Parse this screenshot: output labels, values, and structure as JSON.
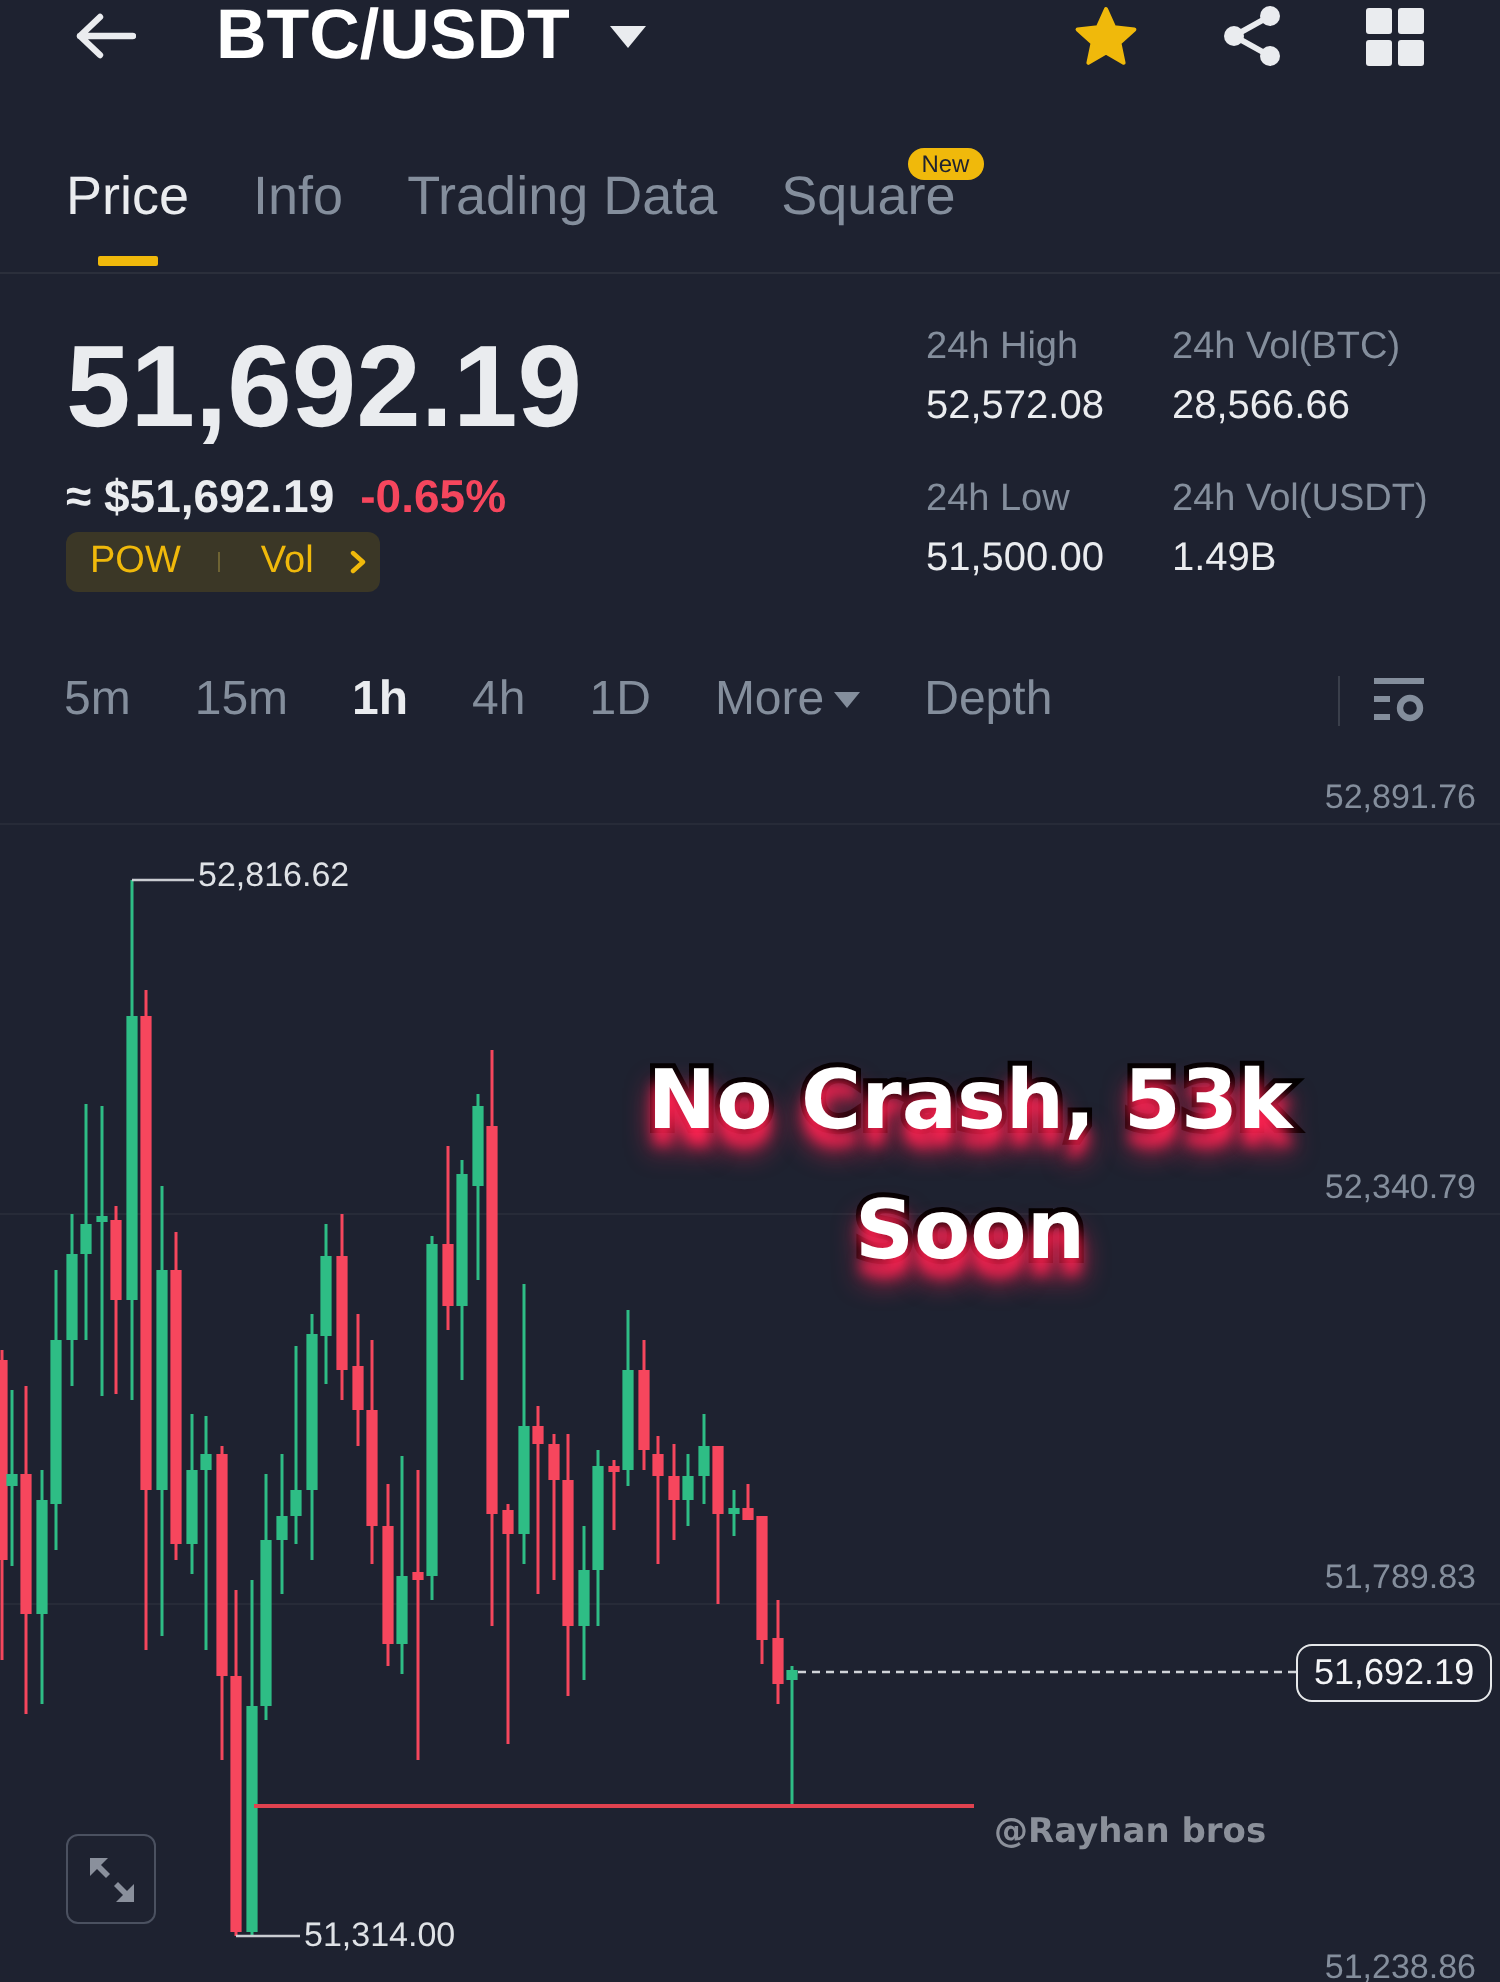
{
  "header": {
    "title": "BTC/USDT",
    "starred": true
  },
  "tabs": [
    {
      "label": "Price",
      "selected": true
    },
    {
      "label": "Info",
      "selected": false
    },
    {
      "label": "Trading Data",
      "selected": false
    },
    {
      "label": "Square",
      "selected": false,
      "badge": "New"
    }
  ],
  "ticker": {
    "last_price": "51,692.19",
    "fiat_price": "≈ $51,692.19",
    "change": "-0.65%",
    "negative": true,
    "tags": [
      "POW",
      "Vol"
    ]
  },
  "stats": [
    {
      "label": "24h High",
      "value": "52,572.08"
    },
    {
      "label": "24h Vol(BTC)",
      "value": "28,566.66"
    },
    {
      "label": "24h Low",
      "value": "51,500.00"
    },
    {
      "label": "24h Vol(USDT)",
      "value": "1.49B"
    }
  ],
  "intervals": [
    {
      "label": "5m",
      "kind": "interval",
      "selected": false
    },
    {
      "label": "15m",
      "kind": "interval",
      "selected": false
    },
    {
      "label": "1h",
      "kind": "interval",
      "selected": true
    },
    {
      "label": "4h",
      "kind": "interval",
      "selected": false
    },
    {
      "label": "1D",
      "kind": "interval",
      "selected": false
    },
    {
      "label": "More",
      "kind": "dropdown",
      "selected": false
    },
    {
      "label": "Depth",
      "kind": "view",
      "selected": false
    }
  ],
  "chart": {
    "price_axis": [
      "52,891.76",
      "52,340.79",
      "51,789.83",
      "51,238.86"
    ],
    "high_label": "52,816.62",
    "low_label": "51,314.00",
    "last_price_tag": "51,692.19",
    "caption": [
      "No Crash, 53k",
      "Soon"
    ],
    "credit": "@Rayhan bros"
  }
}
